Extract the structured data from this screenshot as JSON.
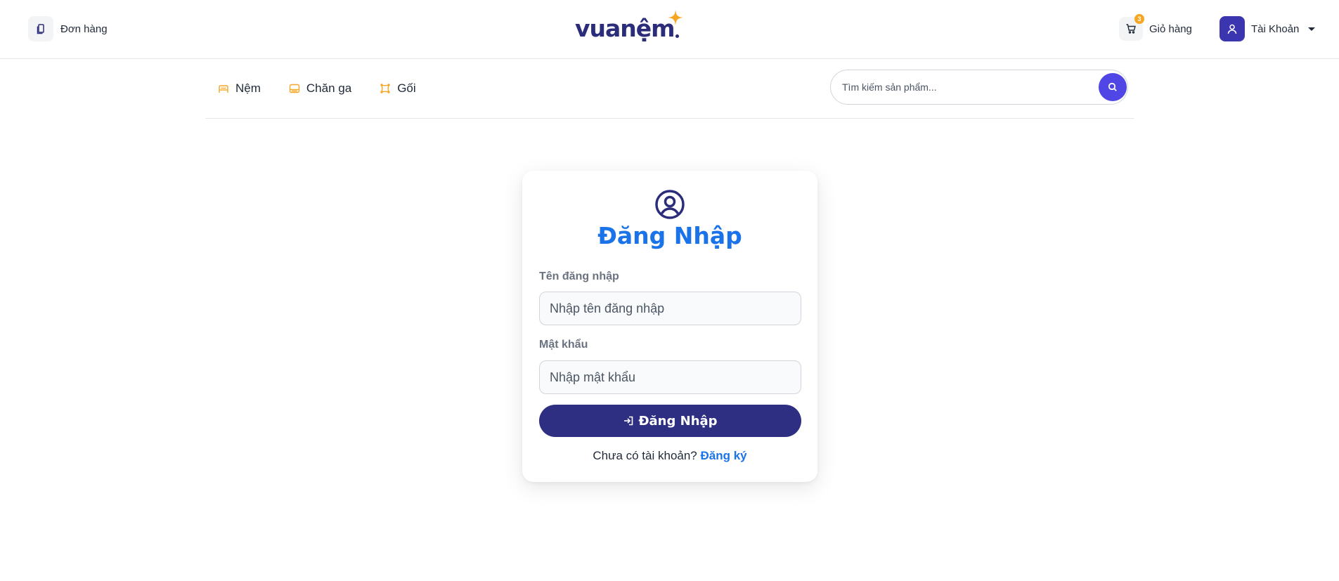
{
  "header": {
    "orders_label": "Đơn hàng",
    "logo_text": "vuanệm",
    "cart_label": "Giỏ hàng",
    "cart_count": "3",
    "account_label": "Tài Khoản"
  },
  "nav": {
    "categories": [
      {
        "label": "Nệm",
        "icon": "bed-icon"
      },
      {
        "label": "Chăn ga",
        "icon": "blanket-icon"
      },
      {
        "label": "Gối",
        "icon": "pillow-icon"
      }
    ],
    "search_placeholder": "Tìm kiếm sản phẩm..."
  },
  "login": {
    "title": "Đăng Nhập",
    "username_label": "Tên đăng nhập",
    "username_placeholder": "Nhập tên đăng nhập",
    "password_label": "Mật khẩu",
    "password_placeholder": "Nhập mật khẩu",
    "submit_label": "Đăng Nhập",
    "no_account_text": "Chưa có tài khoản?",
    "signup_link": "Đăng ký"
  },
  "colors": {
    "brand_navy": "#2e2f82",
    "accent_blue": "#1a73e8",
    "accent_orange": "#f6a623",
    "search_button": "#4f46e5"
  }
}
